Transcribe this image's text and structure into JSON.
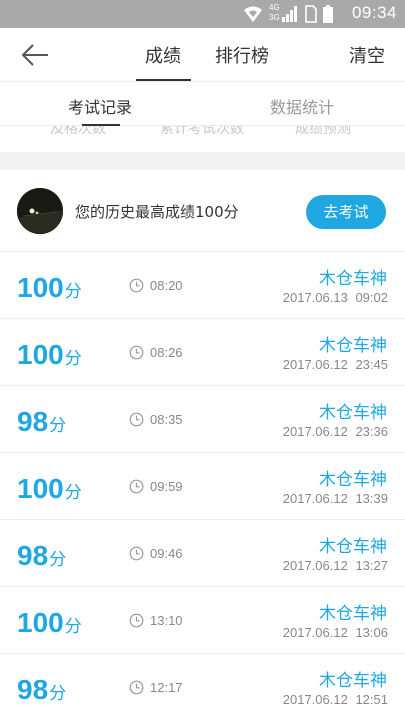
{
  "status_bar": {
    "time": "09:34",
    "network_labels": [
      "4G",
      "3G"
    ],
    "icons": [
      "wifi-icon",
      "signal-icon",
      "sim-icon",
      "battery-icon"
    ]
  },
  "nav": {
    "tabs": [
      {
        "label": "成绩",
        "active": true
      },
      {
        "label": "排行榜",
        "active": false
      }
    ],
    "clear_label": "清空",
    "back_icon": "arrow-left-icon"
  },
  "subtabs": [
    {
      "label": "考试记录",
      "active": true
    },
    {
      "label": "数据统计",
      "active": false
    }
  ],
  "stats_labels": [
    "及格次数",
    "累计考试次数",
    "成绩预测"
  ],
  "best": {
    "text": "您的历史最高成绩100分",
    "button_label": "去考试"
  },
  "records": [
    {
      "score": "100",
      "unit": "分",
      "duration": "08:20",
      "label": "木仓车神",
      "date": "2017.06.13",
      "time": "09:02"
    },
    {
      "score": "100",
      "unit": "分",
      "duration": "08:26",
      "label": "木仓车神",
      "date": "2017.06.12",
      "time": "23:45"
    },
    {
      "score": "98",
      "unit": "分",
      "duration": "08:35",
      "label": "木仓车神",
      "date": "2017.06.12",
      "time": "23:36"
    },
    {
      "score": "100",
      "unit": "分",
      "duration": "09:59",
      "label": "木仓车神",
      "date": "2017.06.12",
      "time": "13:39"
    },
    {
      "score": "98",
      "unit": "分",
      "duration": "09:46",
      "label": "木仓车神",
      "date": "2017.06.12",
      "time": "13:27"
    },
    {
      "score": "100",
      "unit": "分",
      "duration": "13:10",
      "label": "木仓车神",
      "date": "2017.06.12",
      "time": "13:06"
    },
    {
      "score": "98",
      "unit": "分",
      "duration": "12:17",
      "label": "木仓车神",
      "date": "2017.06.12",
      "time": "12:51"
    }
  ],
  "colors": {
    "accent": "#1ea7e1",
    "status_bar": "#a9a9a9",
    "text_primary": "#333333",
    "text_secondary": "#888888"
  }
}
